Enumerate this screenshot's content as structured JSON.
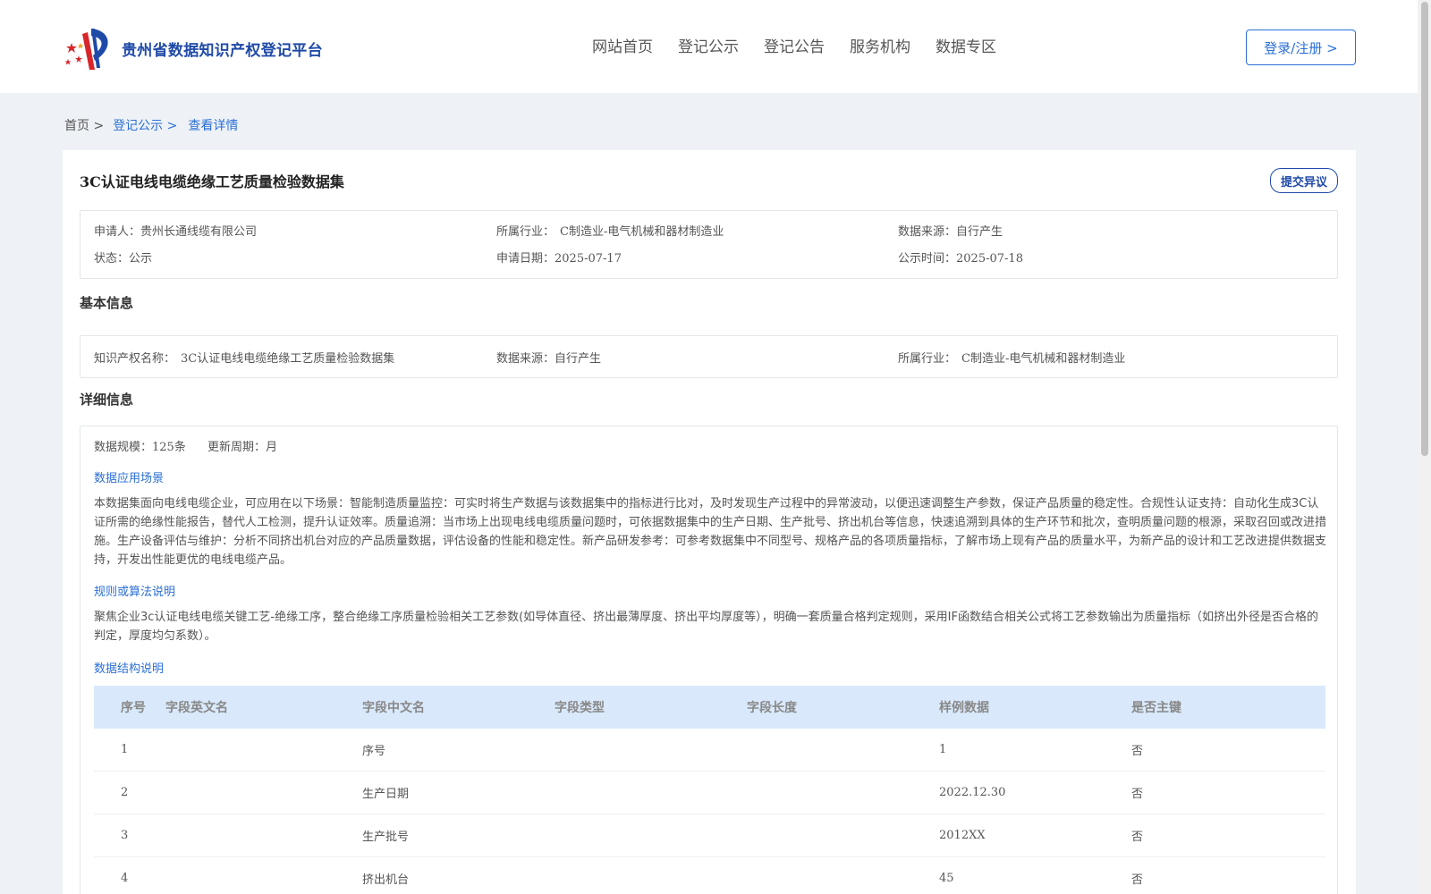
{
  "header": {
    "site_title": "贵州省数据知识产权登记平台",
    "nav": [
      "网站首页",
      "登记公示",
      "登记公告",
      "服务机构",
      "数据专区"
    ],
    "login_label": "登录/注册 >"
  },
  "breadcrumb": {
    "home": "首页 >",
    "section": "登记公示 >",
    "current": "查看详情"
  },
  "record": {
    "title": "3C认证电线电缆绝缘工艺质量检验数据集",
    "objection_label": "提交异议",
    "summary": {
      "applicant_label": "申请人：",
      "applicant": "贵州长通线缆有限公司",
      "industry_label": "所属行业：",
      "industry": "C制造业-电气机械和器材制造业",
      "source_label": "数据来源：",
      "source": "自行产生",
      "status_label": "状态：",
      "status": "公示",
      "apply_date_label": "申请日期：",
      "apply_date": "2025-07-17",
      "publish_date_label": "公示时间：",
      "publish_date": "2025-07-18"
    },
    "basic": {
      "section_title": "基本信息",
      "ip_name_label": "知识产权名称：",
      "ip_name": "3C认证电线电缆绝缘工艺质量检验数据集",
      "source_label": "数据来源：",
      "source": "自行产生",
      "industry_label": "所属行业：",
      "industry": "C制造业-电气机械和器材制造业"
    },
    "detail": {
      "section_title": "详细信息",
      "scale_label": "数据规模：",
      "scale": "125条",
      "cycle_label": "更新周期：",
      "cycle": "月",
      "scenario_title": "数据应用场景",
      "scenario_text": "本数据集面向电线电缆企业，可应用在以下场景：智能制造质量监控：可实时将生产数据与该数据集中的指标进行比对，及时发现生产过程中的异常波动，以便迅速调整生产参数，保证产品质量的稳定性。合规性认证支持：自动化生成3C认证所需的绝缘性能报告，替代人工检测，提升认证效率。质量追溯：当市场上出现电线电缆质量问题时，可依据数据集中的生产日期、生产批号、挤出机台等信息，快速追溯到具体的生产环节和批次，查明质量问题的根源，采取召回或改进措施。生产设备评估与维护：分析不同挤出机台对应的产品质量数据，评估设备的性能和稳定性。新产品研发参考：可参考数据集中不同型号、规格产品的各项质量指标，了解市场上现有产品的质量水平，为新产品的设计和工艺改进提供数据支持，开发出性能更优的电线电缆产品。",
      "rule_title": "规则或算法说明",
      "rule_text": "聚焦企业3c认证电线电缆关键工艺-绝缘工序，整合绝缘工序质量检验相关工艺参数(如导体直径、挤出最薄厚度、挤出平均厚度等），明确一套质量合格判定规则，采用IF函数结合相关公式将工艺参数输出为质量指标（如挤出外径是否合格的判定，厚度均匀系数）。",
      "structure_title": "数据结构说明",
      "table": {
        "headers": [
          "序号",
          "字段英文名",
          "字段中文名",
          "字段类型",
          "字段长度",
          "样例数据",
          "是否主键"
        ],
        "rows": [
          [
            "1",
            "",
            "序号",
            "",
            "",
            "1",
            "否"
          ],
          [
            "2",
            "",
            "生产日期",
            "",
            "",
            "2022.12.30",
            "否"
          ],
          [
            "3",
            "",
            "生产批号",
            "",
            "",
            "2012XX",
            "否"
          ],
          [
            "4",
            "",
            "挤出机台",
            "",
            "",
            "45",
            "否"
          ]
        ]
      }
    }
  },
  "colors": {
    "accent": "#2b6fd6",
    "brand": "#1f4aa8",
    "table_header_bg": "#d9e9fb",
    "page_bg": "#eef2f6"
  }
}
